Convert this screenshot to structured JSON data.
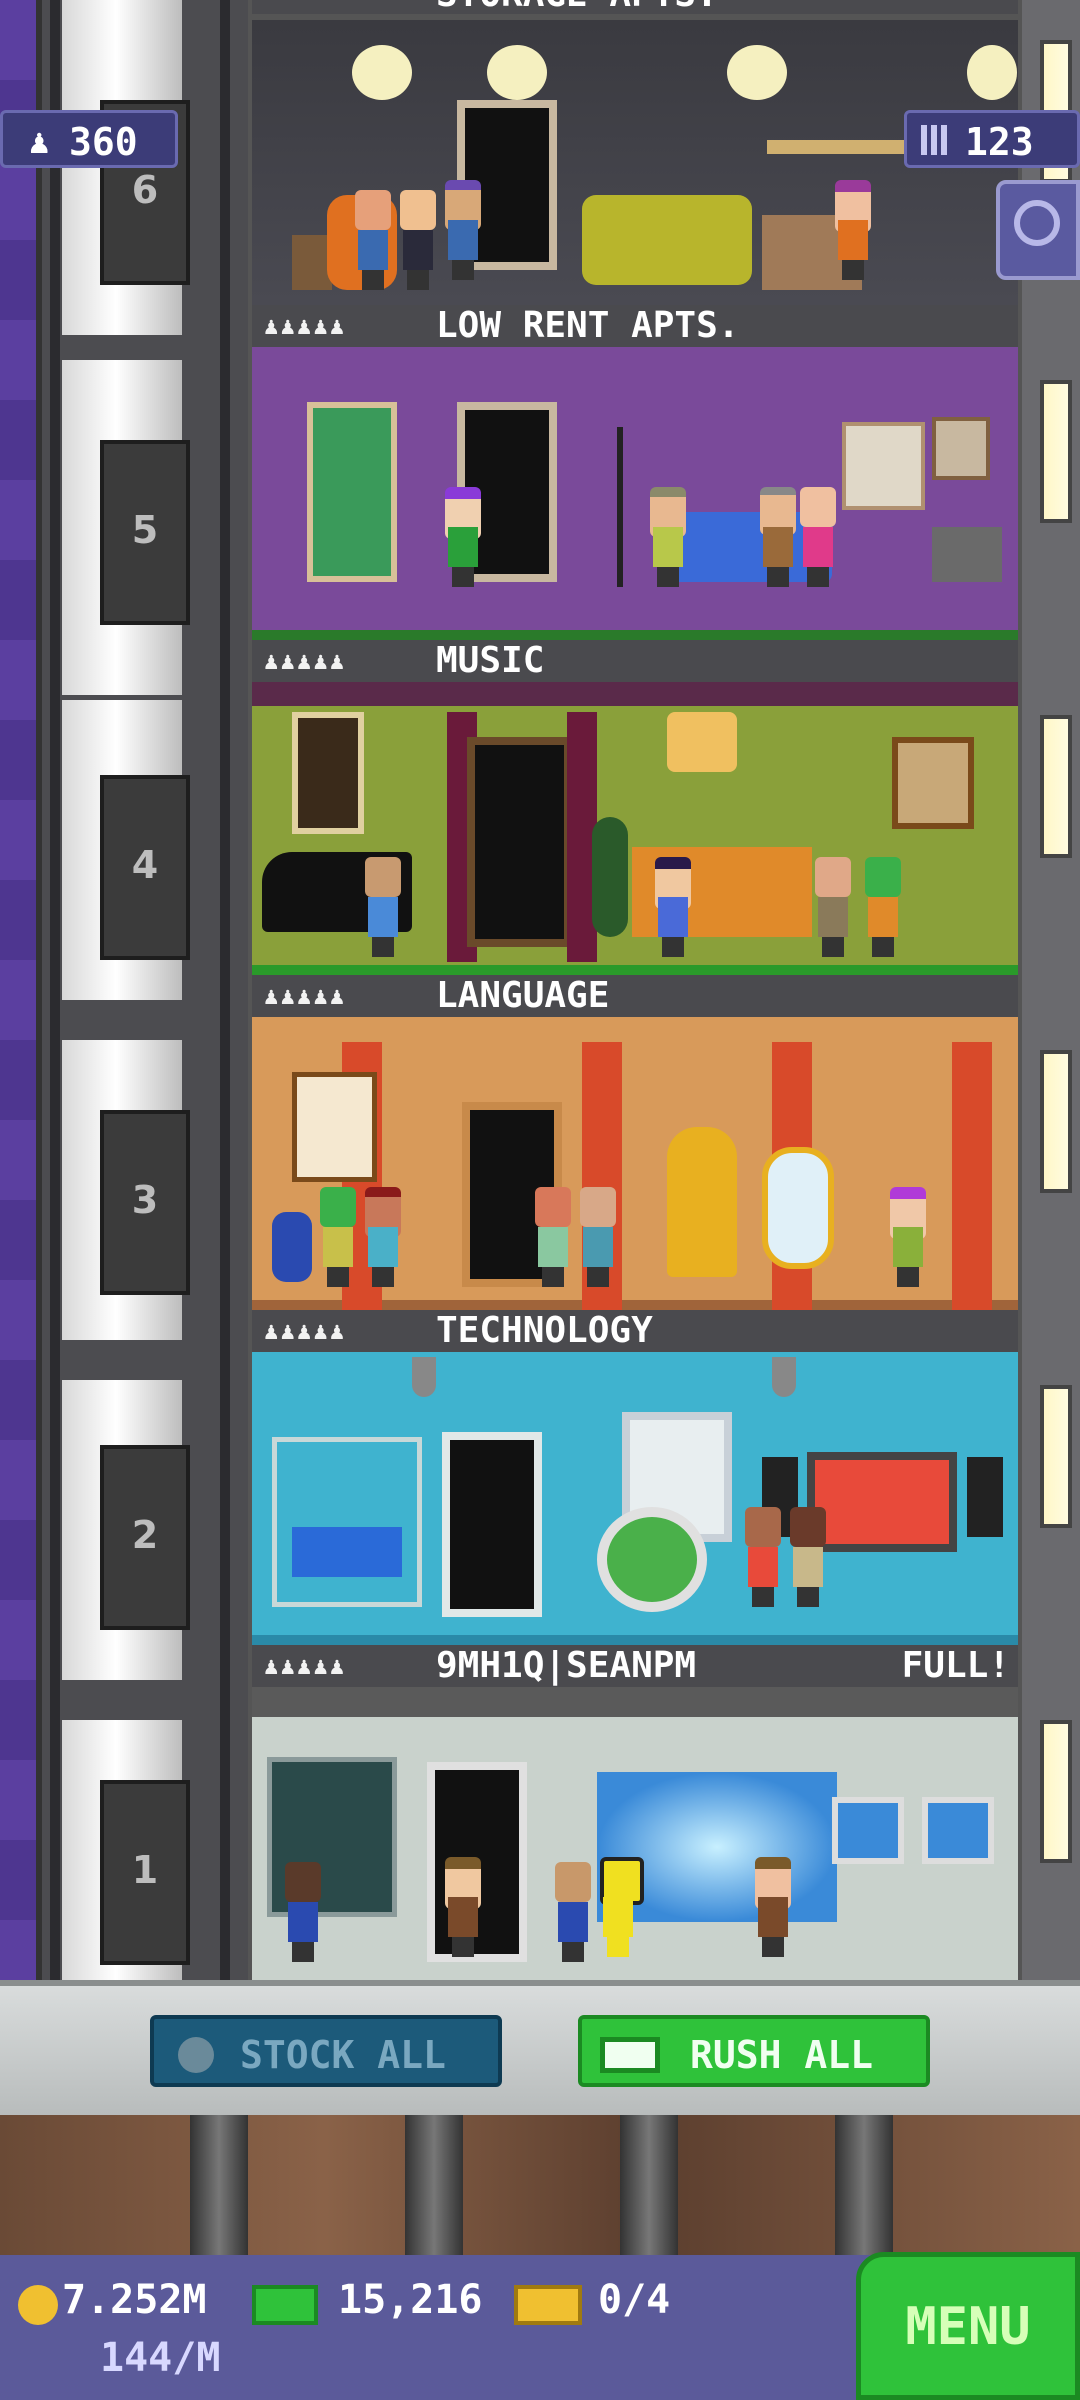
{
  "top_left_counter": {
    "icon": "people-icon",
    "value": "360"
  },
  "top_right_counter": {
    "icon": "building-icon",
    "value": "123"
  },
  "search_button": {
    "icon": "magnifier-icon"
  },
  "partial_top_label": "STORAGE APTS.",
  "floors": [
    {
      "number": "6",
      "name": "",
      "note": ""
    },
    {
      "number": "5",
      "stars": "♟♟♟♟♟",
      "name": "LOW RENT APTS.",
      "note": ""
    },
    {
      "number": "4",
      "stars": "♟♟♟♟♟",
      "name": "MUSIC",
      "note": ""
    },
    {
      "number": "3",
      "stars": "♟♟♟♟♟",
      "name": "LANGUAGE",
      "note": ""
    },
    {
      "number": "2",
      "stars": "♟♟♟♟♟",
      "name": "TECHNOLOGY",
      "note": ""
    },
    {
      "number": "1",
      "stars": "♟♟♟♟♟",
      "name": "9MH1Q|SEANPM",
      "note": "FULL!"
    }
  ],
  "buttons": {
    "stock_all": "STOCK ALL",
    "rush_all": "RUSH ALL"
  },
  "status": {
    "coins": "7.252M",
    "coins_rate": "144/M",
    "bux": "15,216",
    "tickets": "0/4",
    "menu": "MENU"
  },
  "colors": {
    "low_rent_wall": "#7a4a9a",
    "music_wall": "#8aa03a",
    "language_wall": "#d89a5a",
    "technology_wall": "#3fb3cf",
    "lobby_wall": "#c9d2cc",
    "rush_green": "#2fc23a",
    "stock_blue": "#1c5a7a"
  }
}
